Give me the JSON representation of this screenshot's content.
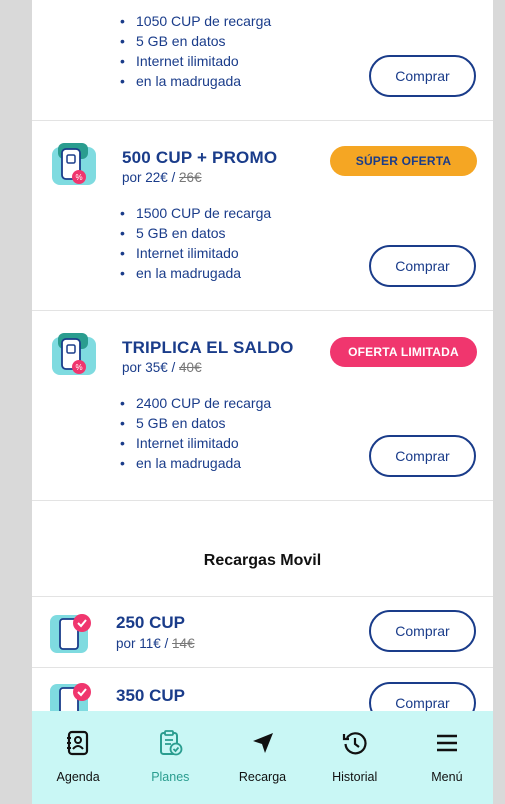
{
  "colors": {
    "primary": "#1a3c8a",
    "teal": "#2a9d8f",
    "orange": "#f5a623",
    "pink": "#f0366e",
    "nav_bg": "#c9f7f5",
    "page_bg": "#d9d9d9"
  },
  "promo_plans": [
    {
      "bullets": [
        "1050 CUP de recarga",
        "5 GB en datos",
        "Internet ilimitado",
        "en la madrugada"
      ],
      "buy_label": "Comprar"
    },
    {
      "title": "500 CUP + PROMO",
      "price_prefix": "por 22€ / ",
      "old_price": "26€",
      "badge": "SÚPER OFERTA",
      "bullets": [
        "1500 CUP de recarga",
        "5 GB en datos",
        "Internet ilimitado",
        "en la madrugada"
      ],
      "buy_label": "Comprar"
    },
    {
      "title": "TRIPLICA EL SALDO",
      "price_prefix": "por 35€ / ",
      "old_price": "40€",
      "badge": "OFERTA LIMITADA",
      "bullets": [
        "2400 CUP de recarga",
        "5 GB en datos",
        "Internet ilimitado",
        "en la madrugada"
      ],
      "buy_label": "Comprar"
    }
  ],
  "mobile_section": {
    "title": "Recargas Movil",
    "items": [
      {
        "title": "250 CUP",
        "price_prefix": "por 11€ / ",
        "old_price": "14€",
        "buy_label": "Comprar"
      },
      {
        "title": "350 CUP",
        "buy_label": "Comprar"
      }
    ]
  },
  "nav": {
    "items": [
      {
        "label": "Agenda",
        "icon": "contact-book-icon",
        "active": false
      },
      {
        "label": "Planes",
        "icon": "clipboard-check-icon",
        "active": true
      },
      {
        "label": "Recarga",
        "icon": "send-arrow-icon",
        "active": false
      },
      {
        "label": "Historial",
        "icon": "history-icon",
        "active": false
      },
      {
        "label": "Menú",
        "icon": "hamburger-menu-icon",
        "active": false
      }
    ]
  }
}
